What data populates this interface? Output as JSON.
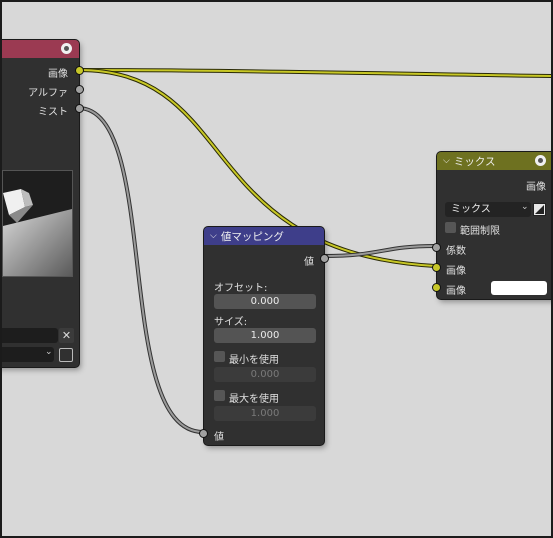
{
  "render_layers_node": {
    "outputs": [
      "画像",
      "アルファ",
      "ミスト"
    ]
  },
  "map_value_node": {
    "title": "値マッピング",
    "output_label": "値",
    "offset_label": "オフセット:",
    "offset_value": "0.000",
    "size_label": "サイズ:",
    "size_value": "1.000",
    "use_min_label": "最小を使用",
    "min_value": "0.000",
    "use_max_label": "最大を使用",
    "max_value": "1.000",
    "input_label": "値"
  },
  "mix_node": {
    "title": "ミックス",
    "output_label": "画像",
    "blend_mode": "ミックス",
    "clamp_label": "範囲制限",
    "inputs": [
      "係数",
      "画像",
      "画像"
    ],
    "color_swatch": "#ffffff"
  },
  "colors": {
    "render_header": "#9b3a52",
    "map_value_header": "#3e3e8a",
    "mix_header": "#6e7120",
    "link_yellow": "#c8c826",
    "link_gray": "#9a9a9a"
  }
}
